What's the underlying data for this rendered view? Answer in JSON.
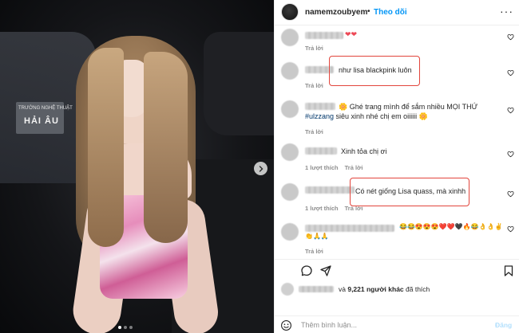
{
  "header": {
    "username": "namemzoubyem",
    "separator": "•",
    "follow_label": "Theo dõi",
    "more_label": "···"
  },
  "photo": {
    "sign_small": "TRƯỜNG NGHỆ THUẬT",
    "sign_big": "HẢI ÂU",
    "slides": 3,
    "active_slide": 1
  },
  "comments": [
    {
      "text": "❤❤",
      "meta": [
        "Trả lời"
      ]
    },
    {
      "text": "như lisa blackpink luôn",
      "meta": [
        "Trả lời"
      ]
    },
    {
      "text_line1": "🌼 Ghé trang mình để sắm nhiều MỌI THỨ",
      "hashtag": "#ulzzang",
      "text_line2": " siêu xinh nhé chị em oiiiiii 🌼",
      "meta": [
        "Trả lời"
      ]
    },
    {
      "text": "Xinh tỏa chị ơi",
      "meta": [
        "1 lượt thích",
        "Trả lời"
      ]
    },
    {
      "text": "Có nét giống Lisa quass, mà xinhh",
      "meta": [
        "1 lượt thích",
        "Trả lời"
      ]
    },
    {
      "text": "😂😂😍😍😍❤️❤️🖤🔥😂👌👌✌️",
      "text_line2": "👏🙏🙏",
      "meta": [
        "Trả lời"
      ]
    }
  ],
  "likes": {
    "prefix": "và ",
    "count": "9,221 người khác",
    "suffix": " đã thích"
  },
  "add_comment": {
    "placeholder": "Thêm bình luận...",
    "post_label": "Đăng"
  },
  "colors": {
    "accent": "#0095f6",
    "highlight": "#e2453c",
    "heart_red": "#ed4956"
  },
  "icons": [
    "chevron-right-icon",
    "heart-outline-icon",
    "comment-icon",
    "share-icon",
    "bookmark-icon",
    "emoji-icon",
    "more-icon"
  ]
}
